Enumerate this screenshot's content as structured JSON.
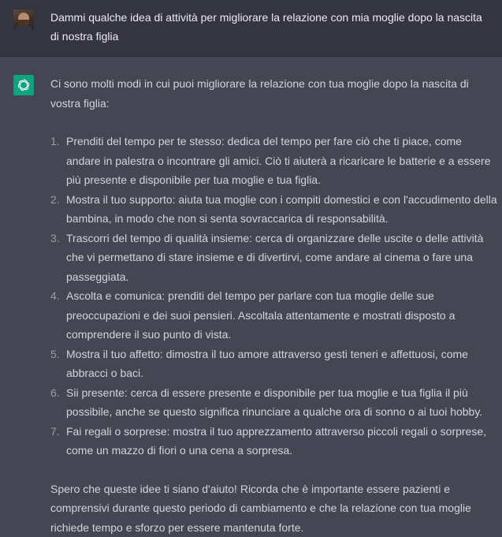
{
  "user": {
    "message": "Dammi qualche idea di attività per migliorare la relazione con mia moglie dopo la nascita di nostra figlia"
  },
  "assistant": {
    "intro": "Ci sono molti modi in cui puoi migliorare la relazione con tua moglie dopo la nascita di vostra figlia:",
    "items": [
      {
        "num": "1.",
        "text": "Prenditi del tempo per te stesso: dedica del tempo per fare ciò che ti piace, come andare in palestra o incontrare gli amici. Ciò ti aiuterà a ricaricare le batterie e a essere più presente e disponibile per tua moglie e tua figlia."
      },
      {
        "num": "2.",
        "text": "Mostra il tuo supporto: aiuta tua moglie con i compiti domestici e con l'accudimento della bambina, in modo che non si senta sovraccarica di responsabilità."
      },
      {
        "num": "3.",
        "text": "Trascorri del tempo di qualità insieme: cerca di organizzare delle uscite o delle attività che vi permettano di stare insieme e di divertirvi, come andare al cinema o fare una passeggiata."
      },
      {
        "num": "4.",
        "text": "Ascolta e comunica: prenditi del tempo per parlare con tua moglie delle sue preoccupazioni e dei suoi pensieri. Ascoltala attentamente e mostrati disposto a comprendere il suo punto di vista."
      },
      {
        "num": "5.",
        "text": "Mostra il tuo affetto: dimostra il tuo amore attraverso gesti teneri e affettuosi, come abbracci o baci."
      },
      {
        "num": "6.",
        "text": "Sii presente: cerca di essere presente e disponibile per tua moglie e tua figlia il più possibile, anche se questo significa rinunciare a qualche ora di sonno o ai tuoi hobby."
      },
      {
        "num": "7.",
        "text": "Fai regali o sorprese: mostra il tuo apprezzamento attraverso piccoli regali o sorprese, come un mazzo di fiori o una cena a sorpresa."
      }
    ],
    "outro": "Spero che queste idee ti siano d'aiuto! Ricorda che è importante essere pazienti e comprensivi durante questo periodo di cambiamento e che la relazione con tua moglie richiede tempo e sforzo per essere mantenuta forte."
  },
  "colors": {
    "user_bg": "#343541",
    "assistant_bg": "#444654",
    "brand": "#10a37f"
  },
  "icons": {
    "user_avatar": "user-avatar-photo",
    "assistant_avatar": "openai-logo-icon"
  }
}
